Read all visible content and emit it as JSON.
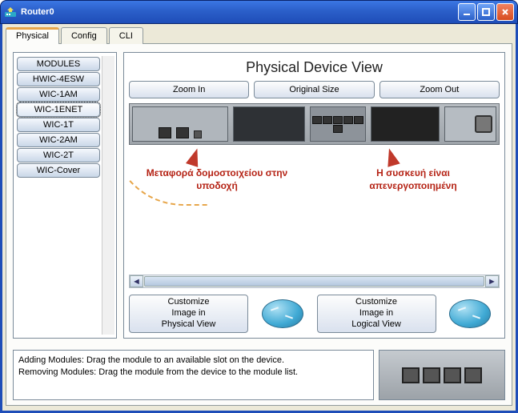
{
  "window": {
    "title": "Router0"
  },
  "tabs": {
    "physical": "Physical",
    "config": "Config",
    "cli": "CLI"
  },
  "sidebar": {
    "header": "MODULES",
    "items": [
      "HWIC-4ESW",
      "WIC-1AM",
      "WIC-1ENET",
      "WIC-1T",
      "WIC-2AM",
      "WIC-2T",
      "WIC-Cover"
    ],
    "selected_index": 2
  },
  "pane": {
    "title": "Physical Device View",
    "zoom_in": "Zoom In",
    "original": "Original Size",
    "zoom_out": "Zoom Out"
  },
  "annotations": {
    "left": "Μεταφορά δομοστοιχείου στην υποδοχή",
    "right": "Η συσκευή είναι απενεργοποιημένη"
  },
  "customize": {
    "physical": "Customize\nImage in\nPhysical View",
    "logical": "Customize\nImage in\nLogical View"
  },
  "help": {
    "line1": "Adding Modules: Drag the module to an available slot on the device.",
    "line2": "Removing Modules: Drag the module from the device to the module list."
  }
}
